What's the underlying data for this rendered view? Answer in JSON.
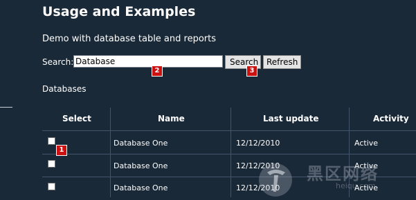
{
  "header": {
    "title": "Usage and Examples",
    "subtitle": "Demo with database table and reports"
  },
  "search": {
    "label": "Search:",
    "value": "Database",
    "search_button": "Search",
    "refresh_button": "Refresh"
  },
  "section": {
    "label": "Databases"
  },
  "table": {
    "columns": [
      "Select",
      "Name",
      "Last update",
      "Activity"
    ],
    "rows": [
      {
        "name": "Database One",
        "last_update": "12/12/2010",
        "activity": "Active"
      },
      {
        "name": "Database One",
        "last_update": "12/12/2010",
        "activity": "Active"
      },
      {
        "name": "Database One",
        "last_update": "12/12/2010",
        "activity": "Active"
      }
    ]
  },
  "markers": [
    "1",
    "2",
    "3"
  ],
  "watermark": {
    "text": "黑区网络",
    "sub": "heiqu.com"
  },
  "colors": {
    "background": "#1a2938",
    "grid_lines": "#43556a",
    "marker": "#cc1111"
  }
}
